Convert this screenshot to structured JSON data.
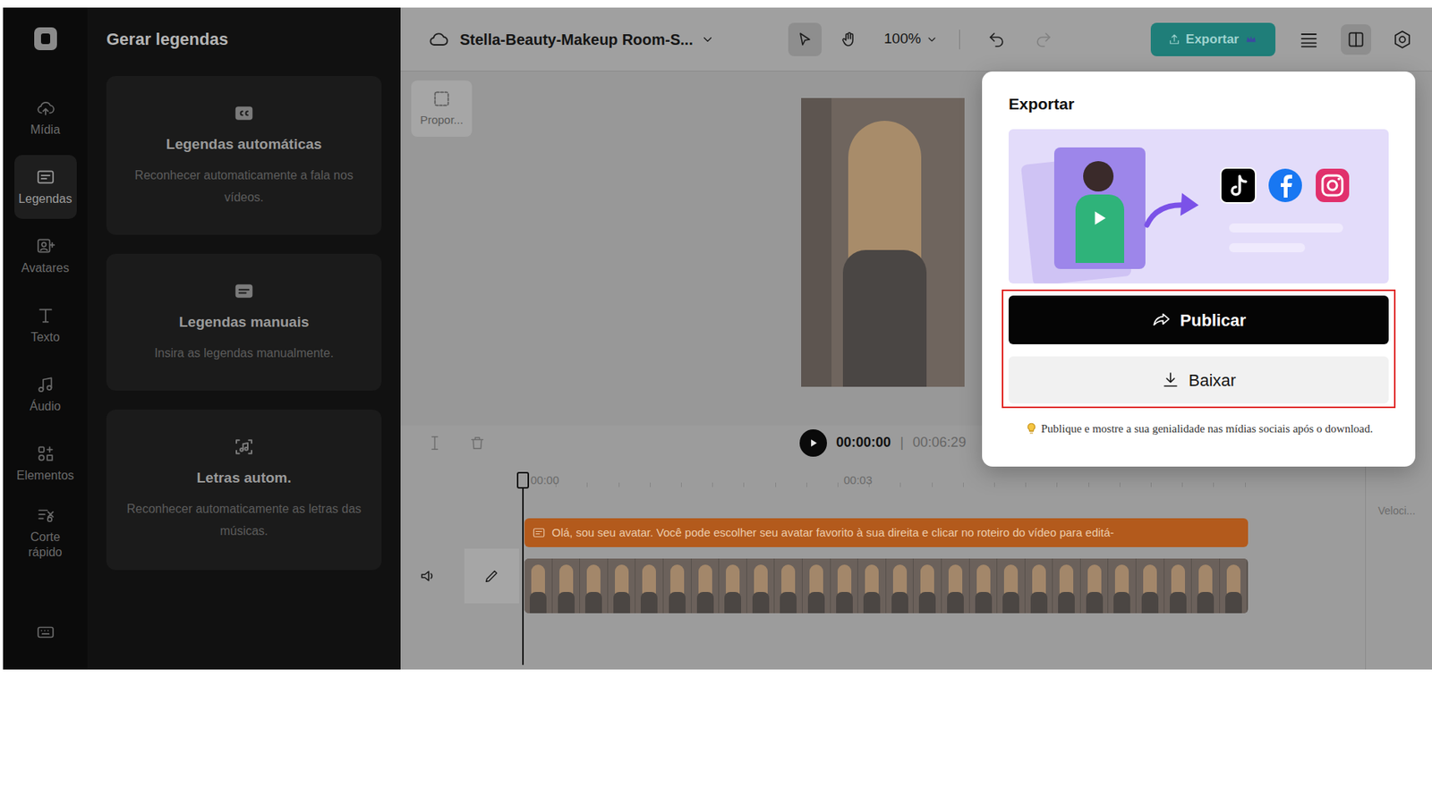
{
  "rail": {
    "items": [
      {
        "label": "Mídia",
        "selected": false
      },
      {
        "label": "Legendas",
        "selected": true
      },
      {
        "label": "Avatares",
        "selected": false
      },
      {
        "label": "Texto",
        "selected": false
      },
      {
        "label": "Áudio",
        "selected": false
      },
      {
        "label": "Elementos",
        "selected": false
      },
      {
        "label": "Corte rápido",
        "selected": false
      }
    ]
  },
  "panel": {
    "title": "Gerar legendas",
    "cards": [
      {
        "title": "Legendas automáticas",
        "description": "Reconhecer automaticamente a fala nos vídeos."
      },
      {
        "title": "Legendas manuais",
        "description": "Insira as legendas manualmente."
      },
      {
        "title": "Letras autom.",
        "description": "Reconhecer automaticamente as letras das músicas."
      }
    ]
  },
  "topbar": {
    "project": "Stella-Beauty-Makeup Room-S...",
    "zoom": "100%",
    "export": "Exportar"
  },
  "canvas": {
    "ratio_button": "Propor..."
  },
  "timeline": {
    "current": "00:00:00",
    "separator": "|",
    "duration": "00:06:29",
    "ticks": [
      "00:00",
      "00:03"
    ],
    "caption": "Olá, sou seu avatar. Você pode escolher seu avatar favorito à sua direita e clicar no roteiro do vídeo para editá-"
  },
  "right_panel": {
    "label": "Veloci..."
  },
  "export_dialog": {
    "title": "Exportar",
    "publish": "Publicar",
    "download": "Baixar",
    "hint": "Publique e mostre a sua genialidade nas mídias sociais após o download."
  }
}
